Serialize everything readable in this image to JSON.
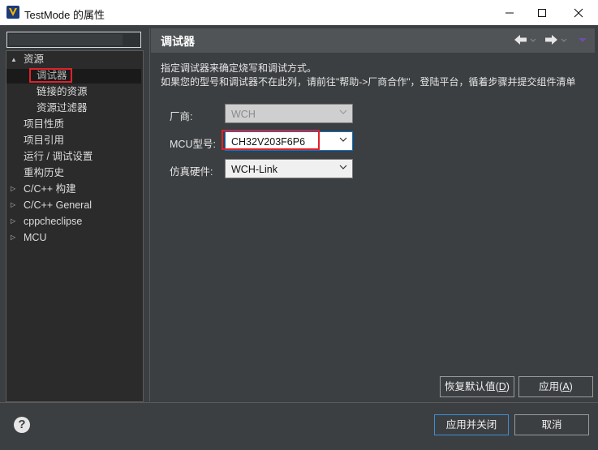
{
  "window": {
    "title": "TestMode 的属性",
    "minimize": "—",
    "maximize": "☐",
    "close": "✕"
  },
  "tree": {
    "items": [
      {
        "label": "资源",
        "expanded": true
      },
      {
        "label": "调试器"
      },
      {
        "label": "链接的资源"
      },
      {
        "label": "资源过滤器"
      },
      {
        "label": "项目性质"
      },
      {
        "label": "项目引用"
      },
      {
        "label": "运行 / 调试设置"
      },
      {
        "label": "重构历史"
      },
      {
        "label": "C/C++ 构建"
      },
      {
        "label": "C/C++ General"
      },
      {
        "label": "cppcheclipse"
      },
      {
        "label": "MCU"
      }
    ]
  },
  "page": {
    "title": "调试器",
    "desc_line1": "指定调试器来确定烧写和调试方式。",
    "desc_line2": "如果您的型号和调试器不在此列，请前往\"帮助->厂商合作\"，登陆平台，循着步骤并提交组件清单",
    "vendor_label": "厂商:",
    "vendor_value": "WCH",
    "mcu_label": "MCU型号:",
    "mcu_value": "CH32V203F6P6",
    "emulator_label": "仿真硬件:",
    "emulator_value": "WCH-Link"
  },
  "buttons": {
    "restore_defaults": "恢复默认值",
    "restore_defaults_key": "D",
    "apply": "应用",
    "apply_key": "A",
    "apply_close": "应用并关闭",
    "cancel": "取消",
    "help": "?"
  },
  "icons": {
    "app": "app-logo-icon",
    "back": "back-arrow-icon",
    "forward": "forward-arrow-icon",
    "menu": "view-menu-icon"
  },
  "colors": {
    "highlight": "#e0212a",
    "background": "#3c3f41",
    "tree_background": "#2b2b2b"
  }
}
